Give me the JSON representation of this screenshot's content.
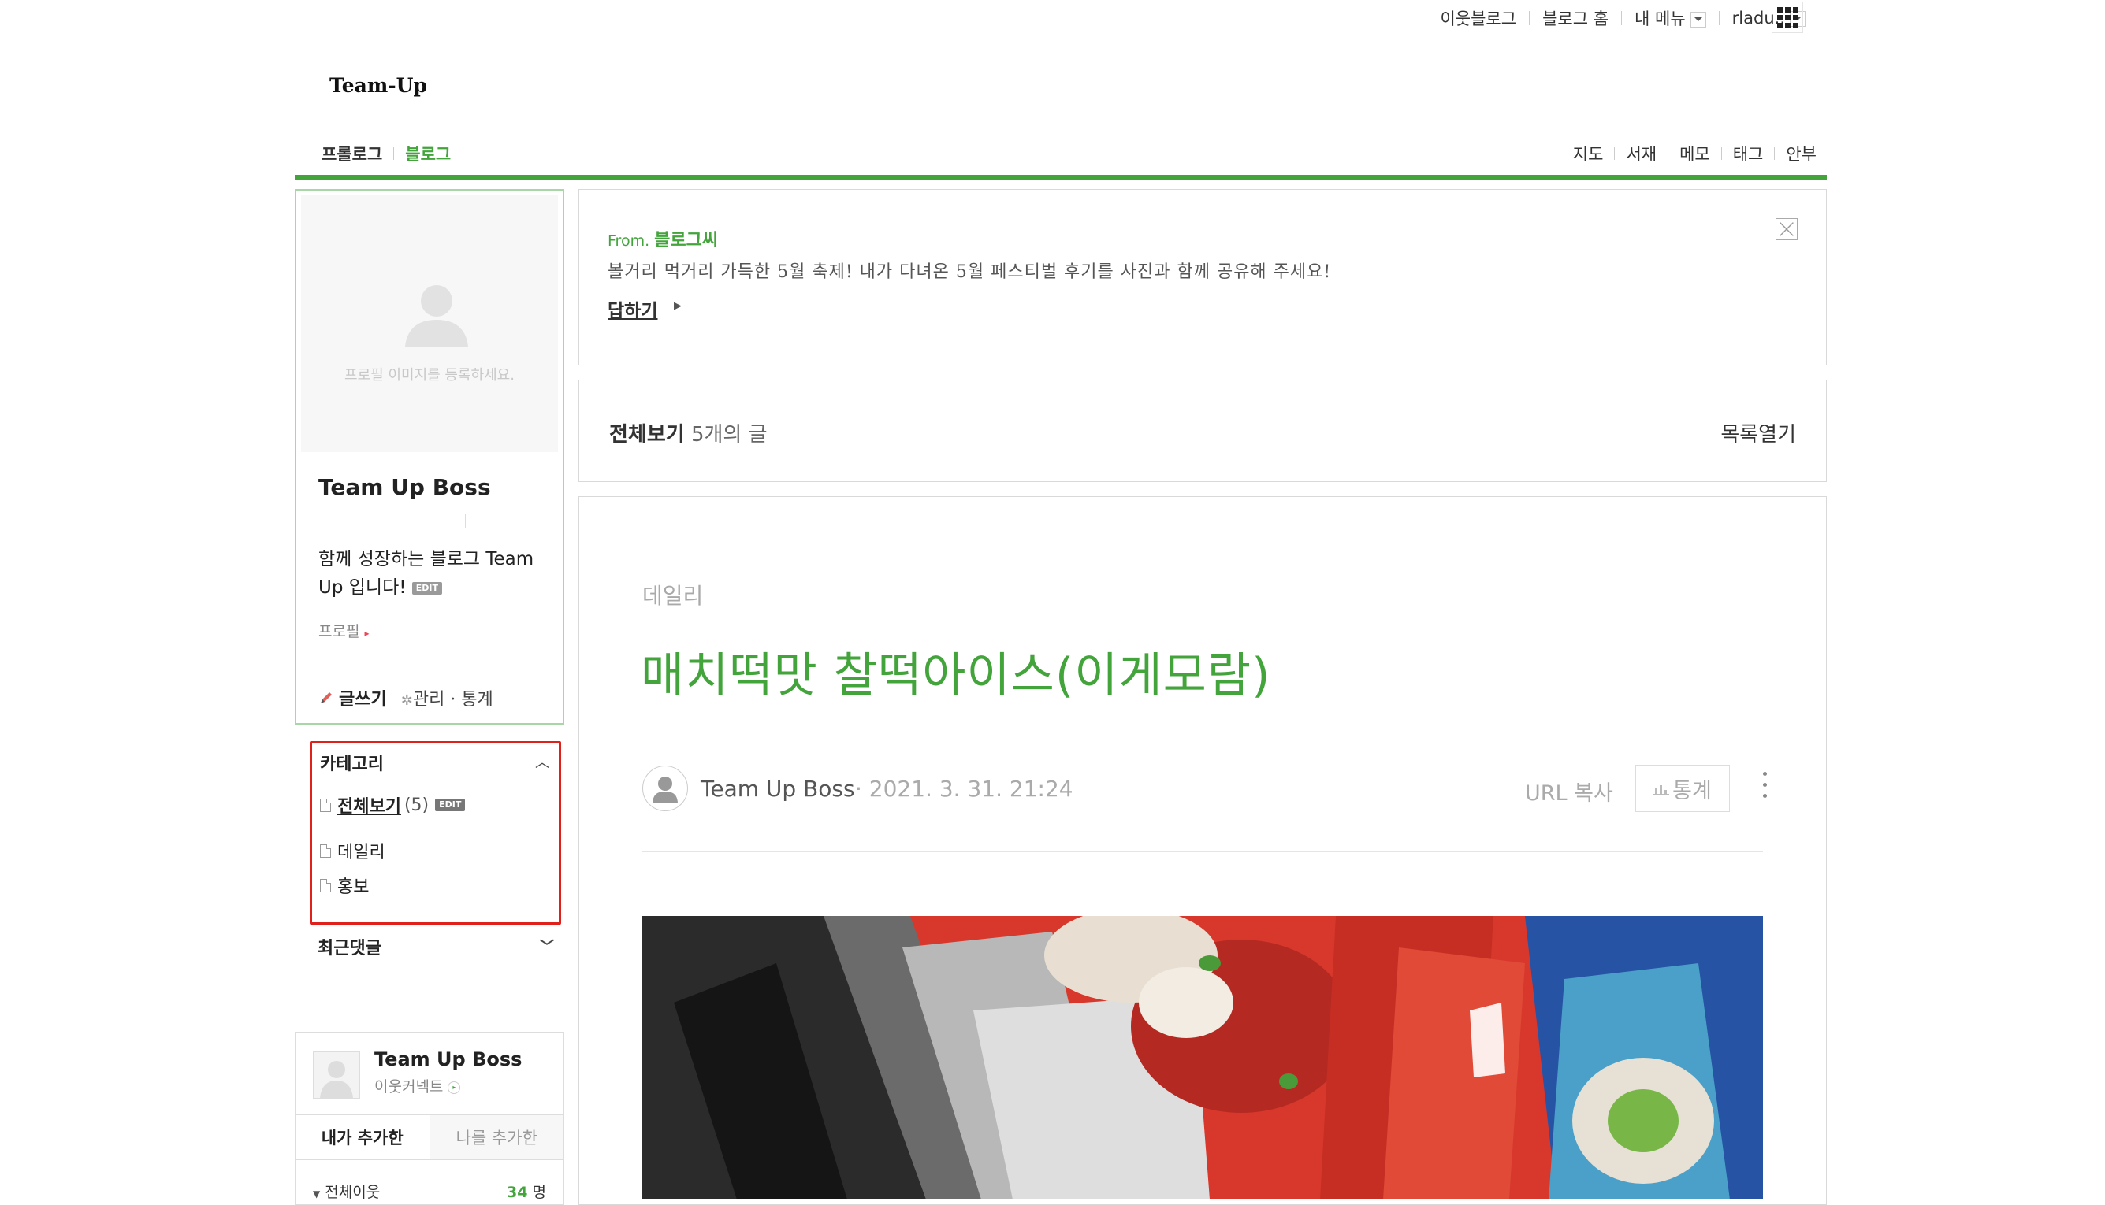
{
  "gnb": {
    "neighbor_blog": "이웃블로그",
    "blog_home": "블로그 홈",
    "my_menu": "내 메뉴",
    "user": "rladu..",
    "apps_icon": "grid-icon"
  },
  "blog": {
    "title": "Team-Up",
    "menu_left": [
      "프롤로그",
      "블로그"
    ],
    "menu_right": [
      "지도",
      "서재",
      "메모",
      "태그",
      "안부"
    ]
  },
  "profile": {
    "image_hint": "프로필 이미지를 등록하세요.",
    "name": "Team Up Boss",
    "description": "함께 성장하는 블로그 Team Up 입니다!",
    "edit_badge": "EDIT",
    "profile_link": "프로필",
    "write": "글쓰기",
    "manage": "관리 · 통계"
  },
  "category": {
    "title": "카테고리",
    "items": [
      {
        "label": "전체보기",
        "count": "(5)"
      },
      {
        "label": "데일리"
      },
      {
        "label": "홍보"
      }
    ],
    "edit_badge": "EDIT"
  },
  "recent_comments": {
    "title": "최근댓글"
  },
  "neighbor": {
    "name": "Team Up Boss",
    "connect": "이웃커넥트",
    "tabs": [
      "내가 추가한",
      "나를 추가한"
    ],
    "all_label": "전체이웃",
    "count": "34",
    "count_unit": "명"
  },
  "notice": {
    "from_prefix": "From.",
    "from_name": "블로그씨",
    "text": "볼거리 먹거리 가득한 5월 축제! 내가 다녀온 5월 페스티벌 후기를 사진과 함께 공유해 주세요!",
    "answer": "답하기"
  },
  "list": {
    "title": "전체보기",
    "count": "5개의 글",
    "open": "목록열기"
  },
  "post": {
    "category": "데일리",
    "title": "매치떡맛 찰떡아이스(이게모람)",
    "author": "Team Up Boss",
    "date": "· 2021. 3. 31. 21:24",
    "url_copy": "URL 복사",
    "stats": "통계"
  },
  "colors": {
    "accent": "#43a43c",
    "highlight_border": "#e0201a"
  }
}
